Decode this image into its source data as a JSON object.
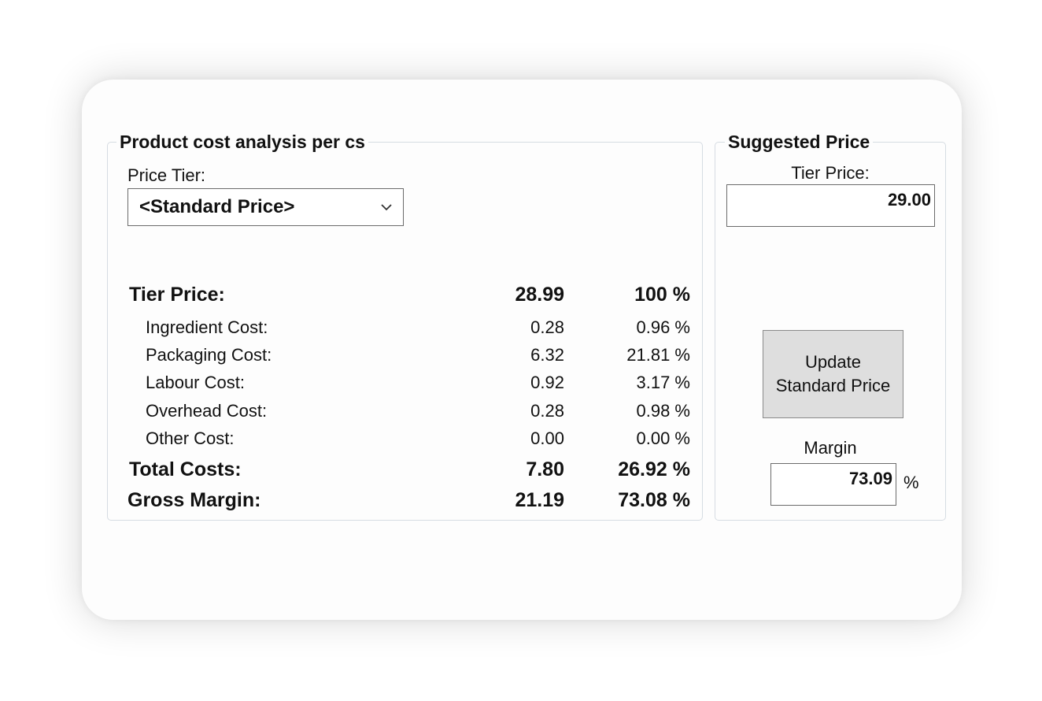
{
  "analysis": {
    "title": "Product cost analysis per cs",
    "price_tier_label": "Price Tier:",
    "price_tier_selected": "<Standard Price>",
    "rows": [
      {
        "label": "Tier Price:",
        "value": "28.99",
        "percent": "100 %"
      },
      {
        "label": "Ingredient Cost:",
        "value": "0.28",
        "percent": "0.96 %"
      },
      {
        "label": "Packaging Cost:",
        "value": "6.32",
        "percent": "21.81 %"
      },
      {
        "label": "Labour Cost:",
        "value": "0.92",
        "percent": "3.17 %"
      },
      {
        "label": "Overhead Cost:",
        "value": "0.28",
        "percent": "0.98 %"
      },
      {
        "label": "Other Cost:",
        "value": "0.00",
        "percent": "0.00 %"
      },
      {
        "label": "Total Costs:",
        "value": "7.80",
        "percent": "26.92 %"
      },
      {
        "label": "Gross Margin:",
        "value": "21.19",
        "percent": "73.08 %"
      }
    ]
  },
  "suggested": {
    "title": "Suggested Price",
    "tier_price_label": "Tier Price:",
    "tier_price_value": "29.00",
    "update_button_line1": "Update",
    "update_button_line2": "Standard Price",
    "margin_label": "Margin",
    "margin_value": "73.09",
    "margin_unit": "%"
  },
  "icons": {
    "dropdown": "chevron-down-icon"
  },
  "colors": {
    "groupbox_border": "#d6dce2",
    "button_face": "#dedede",
    "input_border": "#6b6b6b"
  }
}
